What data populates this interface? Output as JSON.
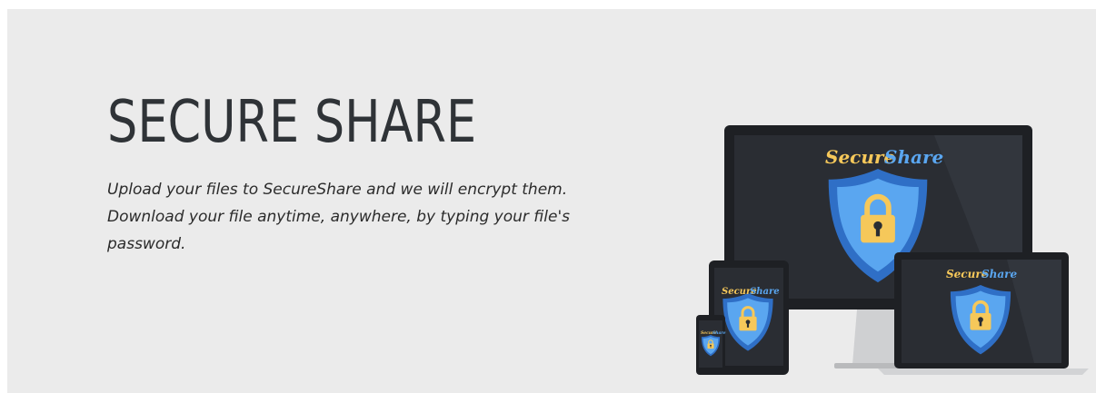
{
  "hero": {
    "title": "SECURE SHARE",
    "description": "Upload your files to SecureShare and we will encrypt them. Download your file anytime, anywhere, by typing your file's password.",
    "brand_word_1": "Secure",
    "brand_word_2": "Share"
  },
  "colors": {
    "background": "#ebebeb",
    "screen": "#2a2d33",
    "shield_outer": "#2f6fc6",
    "shield_inner": "#5aa6f0",
    "lock": "#f6c85a",
    "brand_yellow": "#f6c85a",
    "brand_blue": "#5aa6f0"
  },
  "illustration": {
    "devices": [
      "desktop-monitor",
      "laptop",
      "tablet",
      "phone"
    ]
  }
}
